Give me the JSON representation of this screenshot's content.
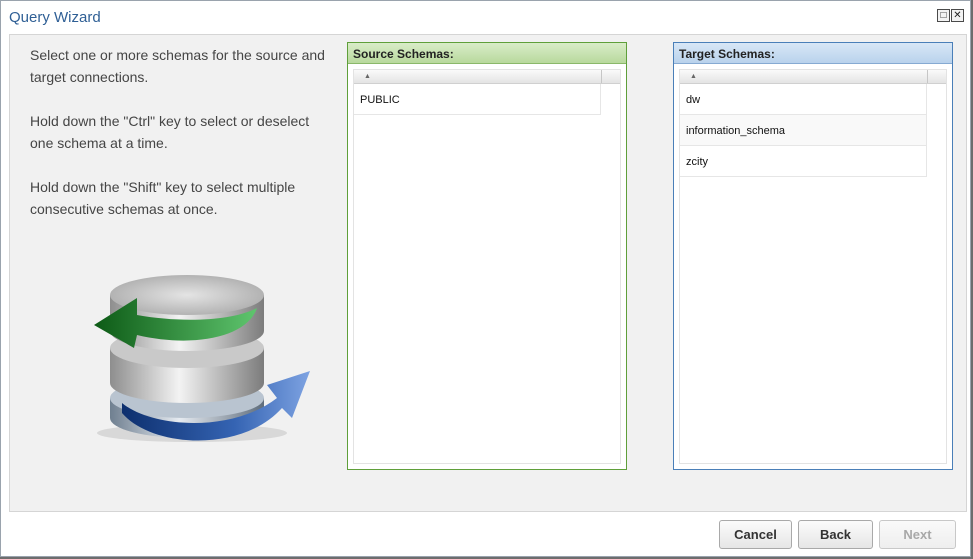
{
  "window": {
    "title": "Query Wizard"
  },
  "instructions": [
    "Select one or more schemas for the source and target connections.",
    "Hold down the \"Ctrl\" key to select or deselect one schema at a time.",
    "Hold down the \"Shift\" key to select multiple consecutive schemas at once."
  ],
  "source": {
    "header": "Source Schemas:",
    "items": [
      "PUBLIC"
    ]
  },
  "target": {
    "header": "Target Schemas:",
    "items": [
      "dw",
      "information_schema",
      "zcity"
    ]
  },
  "buttons": {
    "cancel": "Cancel",
    "back": "Back",
    "next": "Next"
  },
  "colors": {
    "title": "#2f5f95",
    "source_border": "#5f9f3a",
    "target_border": "#4a7fb8"
  }
}
